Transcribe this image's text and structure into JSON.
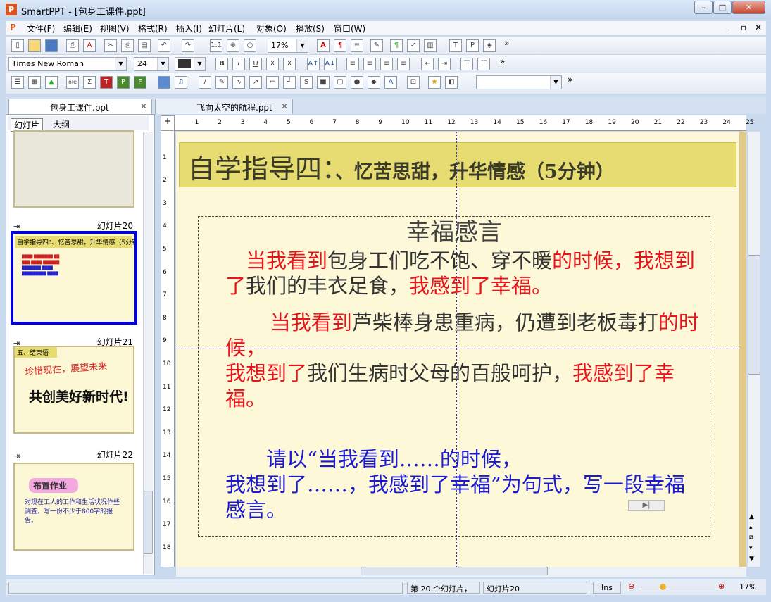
{
  "window": {
    "title": "SmartPPT - [包身工课件.ppt]",
    "app_icon": "P"
  },
  "menu": [
    "文件(F)",
    "编辑(E)",
    "视图(V)",
    "格式(R)",
    "插入(I)",
    "幻灯片(L)",
    "对象(O)",
    "播放(S)",
    "窗口(W)"
  ],
  "toolbar": {
    "zoom": "17%",
    "font": "Times New Roman",
    "size": "24",
    "more": "»"
  },
  "tabs": [
    {
      "label": "包身工课件.ppt"
    },
    {
      "label": "飞向太空的航程.ppt"
    }
  ],
  "panel_tabs": [
    "幻灯片",
    "大纲"
  ],
  "thumbs": [
    {
      "label": "幻灯片20",
      "title": "自学指导四：、忆苦思甜，升华情感（5分钟）"
    },
    {
      "label": "幻灯片21",
      "heading": "五、结束语",
      "line1": "珍惜现在，展望未来",
      "line2": "共创美好新时代!"
    },
    {
      "label": "幻灯片22",
      "badge": "布置作业",
      "text": "对现在工人的工作和生活状况作些调查，写一份不少于800字的报告。"
    }
  ],
  "slide": {
    "title_big": "自学指导四：",
    "title_small": "、忆苦思甜，升华情感（5分钟）",
    "heading": "幸福感言",
    "p1": [
      "当我看到",
      "包身工们吃不饱、穿不暖",
      "的时候，我想到了",
      "我们的丰衣足食，",
      "我感到了幸福。"
    ],
    "p2": [
      "当我看到",
      "芦柴棒身患重病，仍遭到老板毒打",
      "的时候，"
    ],
    "p3": [
      "我想到了",
      "我们生病时父母的百般呵护，",
      "我感到了幸福。"
    ],
    "p4": [
      "请以“当我看到……的时候，",
      "我想到了……，我感到了幸福”为句式，写一段幸福感言。"
    ]
  },
  "status": {
    "slide_pos": "第 20 个幻灯片，",
    "slide_name": "幻灯片20",
    "mode": "Ins",
    "zoom": "17%",
    "zoom_fraction": 0.17
  }
}
